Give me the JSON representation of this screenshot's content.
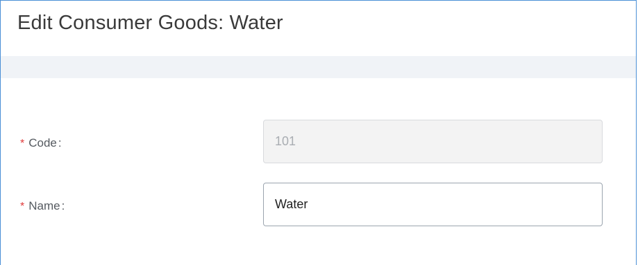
{
  "dialog": {
    "title": "Edit Consumer Goods: Water"
  },
  "form": {
    "code": {
      "required_mark": "*",
      "label": "Code",
      "colon": ":",
      "value": "101"
    },
    "name": {
      "required_mark": "*",
      "label": "Name",
      "colon": ":",
      "value": "Water"
    }
  },
  "colors": {
    "dialog_border": "#4a8fd6",
    "required": "#e03a3a",
    "band": "#f0f3f7"
  }
}
